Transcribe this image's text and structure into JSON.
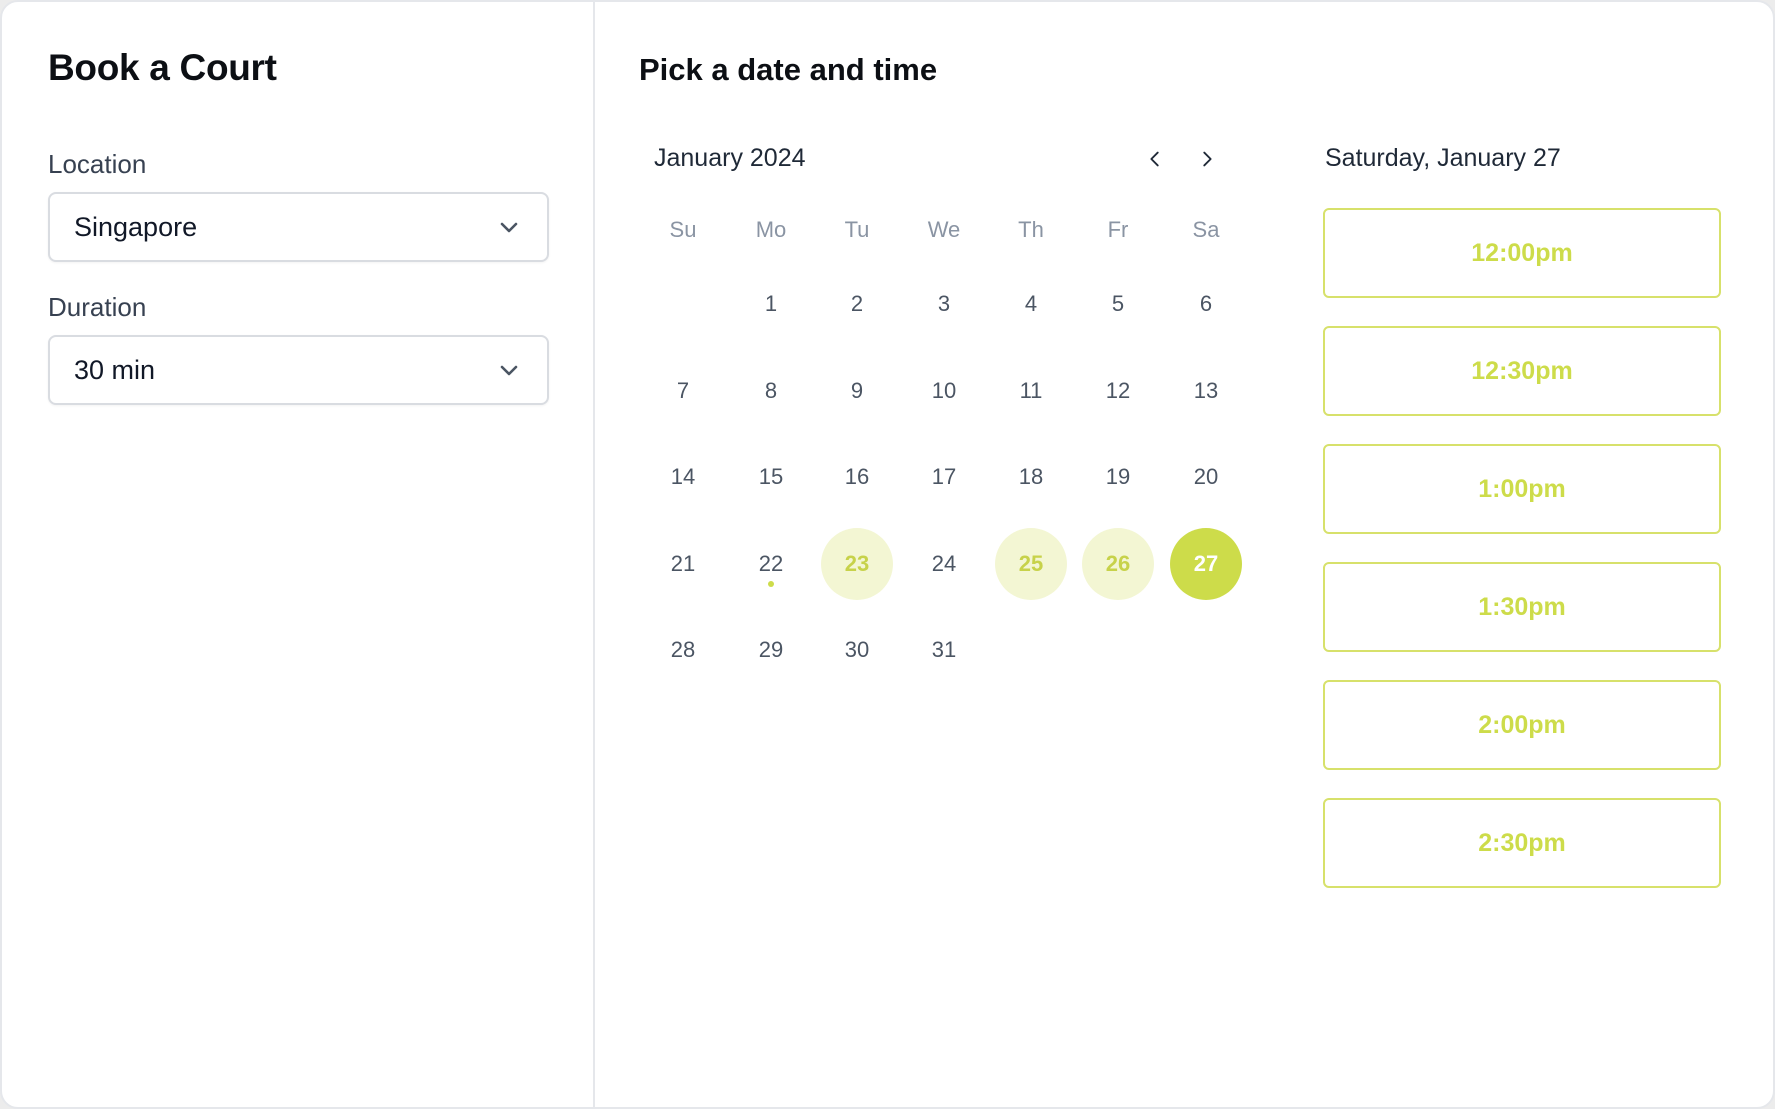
{
  "app": {
    "title": "Book a Court"
  },
  "form": {
    "location_label": "Location",
    "location_value": "Singapore",
    "duration_label": "Duration",
    "duration_value": "30 min"
  },
  "picker": {
    "title": "Pick a date and time",
    "month": "January 2024",
    "weekdays": [
      "Su",
      "Mo",
      "Tu",
      "We",
      "Th",
      "Fr",
      "Sa"
    ],
    "first_weekday_offset": 1,
    "days_in_month": 31,
    "available_days": [
      23,
      25,
      26
    ],
    "selected_day": 27,
    "today_marker_day": 22,
    "selected_date_label": "Saturday, January 27",
    "time_slots": [
      "12:00pm",
      "12:30pm",
      "1:00pm",
      "1:30pm",
      "2:00pm",
      "2:30pm"
    ]
  },
  "icons": {
    "location_chevron": "chevron-down-icon",
    "duration_chevron": "chevron-down-icon",
    "prev": "chevron-left-icon",
    "next": "chevron-right-icon"
  },
  "colors": {
    "accent": "#cddc4a",
    "accent_light": "#f3f6d3",
    "accent_text": "#c7d24a"
  }
}
